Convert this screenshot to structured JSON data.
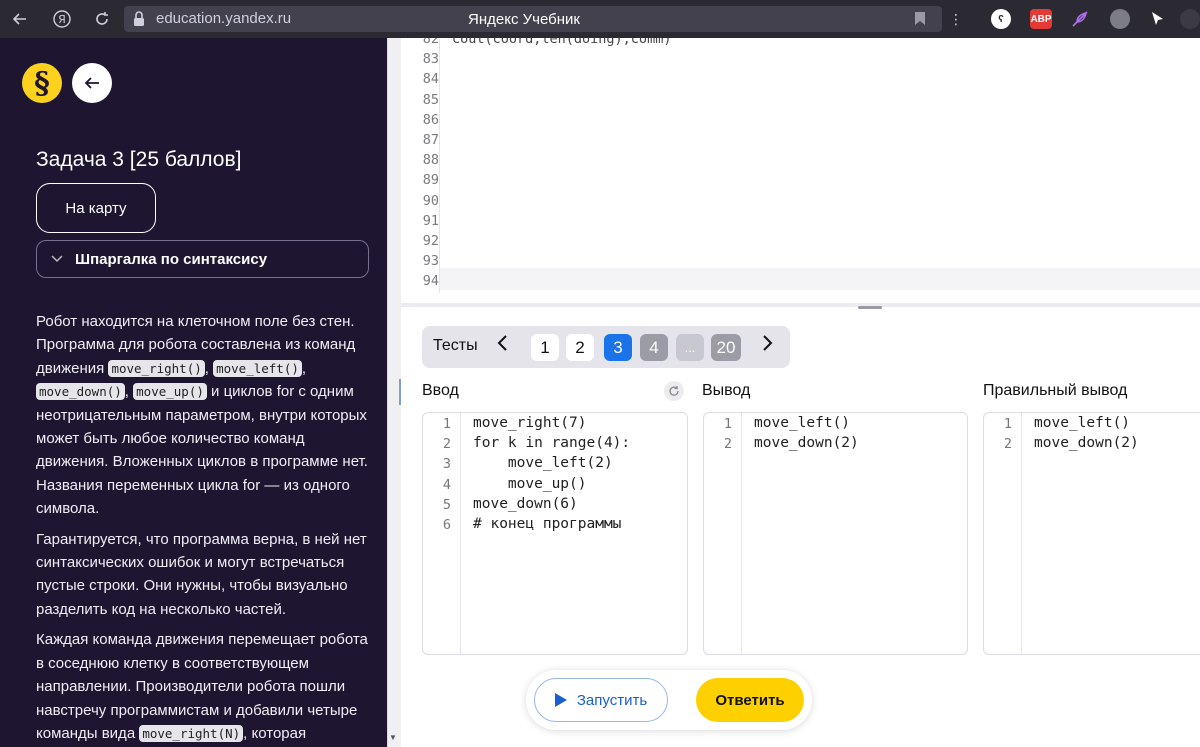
{
  "browser": {
    "url": "education.yandex.ru",
    "title": "Яндекс Учебник",
    "ext_abp": "ABP"
  },
  "sidebar": {
    "logo_glyph": "§",
    "task_title": "Задача 3 [25 баллов]",
    "map_button": "На карту",
    "cheatsheet": "Шпаргалка по синтаксису",
    "p1": {
      "t1": "Робот находится на клеточном поле без стен. Программа для робота составлена из команд движения ",
      "c1": "move_right()",
      "s1": ", ",
      "c2": "move_left()",
      "s2": ", ",
      "c3": "move_down()",
      "s3": ", ",
      "c4": "move_up()",
      "t2": " и циклов for с одним неотрицательным параметром, внутри которых может быть любое количество команд движения. Вложенных циклов в программе нет. Названия переменных цикла for — из одного символа."
    },
    "p2": "Гарантируется, что программа верна, в ней нет синтаксических ошибок и могут встречаться пустые строки. Они нужны, чтобы визуально разделить код на несколько частей.",
    "p3": {
      "t1": "Каждая команда движения перемещает робота в соседнюю клетку в соответствующем направлении. Производители робота пошли навстречу программистам и добавили четыре команды вида ",
      "c1": "move_right(N)",
      "t2": ", которая"
    }
  },
  "editor": {
    "partial_line": "cout(coord,len(doing),comm)",
    "line_numbers": [
      "82",
      "83",
      "84",
      "85",
      "86",
      "87",
      "88",
      "89",
      "90",
      "91",
      "92",
      "93",
      "94"
    ]
  },
  "tests": {
    "label": "Тесты",
    "items": [
      "1",
      "2",
      "3",
      "4",
      "...",
      "20"
    ],
    "active": "3"
  },
  "columns": {
    "input_title": "Ввод",
    "output_title": "Вывод",
    "correct_title": "Правильный вывод"
  },
  "input_lines": [
    {
      "n": "1",
      "t": "move_right(7)"
    },
    {
      "n": "2",
      "t": "for k in range(4):"
    },
    {
      "n": "3",
      "t": "    move_left(2)"
    },
    {
      "n": "4",
      "t": "    move_up()"
    },
    {
      "n": "5",
      "t": "move_down(6)"
    },
    {
      "n": "6",
      "t": "# конец программы"
    }
  ],
  "output_lines": [
    {
      "n": "1",
      "t": "move_left()"
    },
    {
      "n": "2",
      "t": "move_down(2)"
    }
  ],
  "correct_lines": [
    {
      "n": "1",
      "t": "move_left()"
    },
    {
      "n": "2",
      "t": "move_down(2)"
    }
  ],
  "actions": {
    "run": "Запустить",
    "answer": "Ответить"
  },
  "colors": {
    "accent_yellow": "#ffd000",
    "accent_blue": "#1a73e8",
    "sidebar_bg": "#1e1530"
  }
}
